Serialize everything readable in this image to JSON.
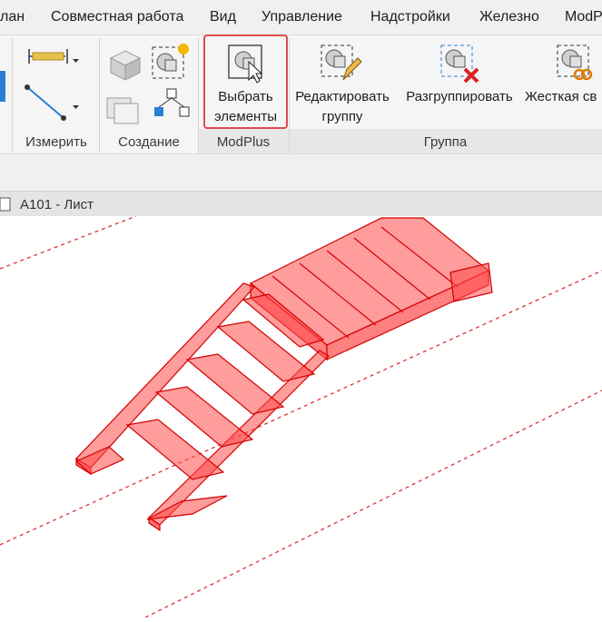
{
  "menu": [
    "лан",
    "Совместная работа",
    "Вид",
    "Управление",
    "Надстройки",
    "Железно",
    "ModP"
  ],
  "panels": {
    "measure_label": "Измерить",
    "create_label": "Создание",
    "modplus_label": "ModPlus",
    "group_label": "Группа"
  },
  "buttons": {
    "select_line1": "Выбрать",
    "select_line2": "элементы",
    "edit_line1": "Редактировать",
    "edit_line2": "группу",
    "ungroup": "Разгруппировать",
    "rigid": "Жесткая св"
  },
  "view_tab": "A101 - Лист",
  "colors": {
    "accent": "#e14a4a",
    "stair_fill": "#ff4a4a",
    "stair_stroke": "#d40000"
  },
  "icons": [
    "dimension-icon",
    "dropdown-arrow-icon",
    "measure-line-icon",
    "create-group-icon",
    "create-similar-icon",
    "model-in-place-icon",
    "select-elements-icon",
    "edit-group-icon",
    "ungroup-icon",
    "rigid-link-icon"
  ]
}
